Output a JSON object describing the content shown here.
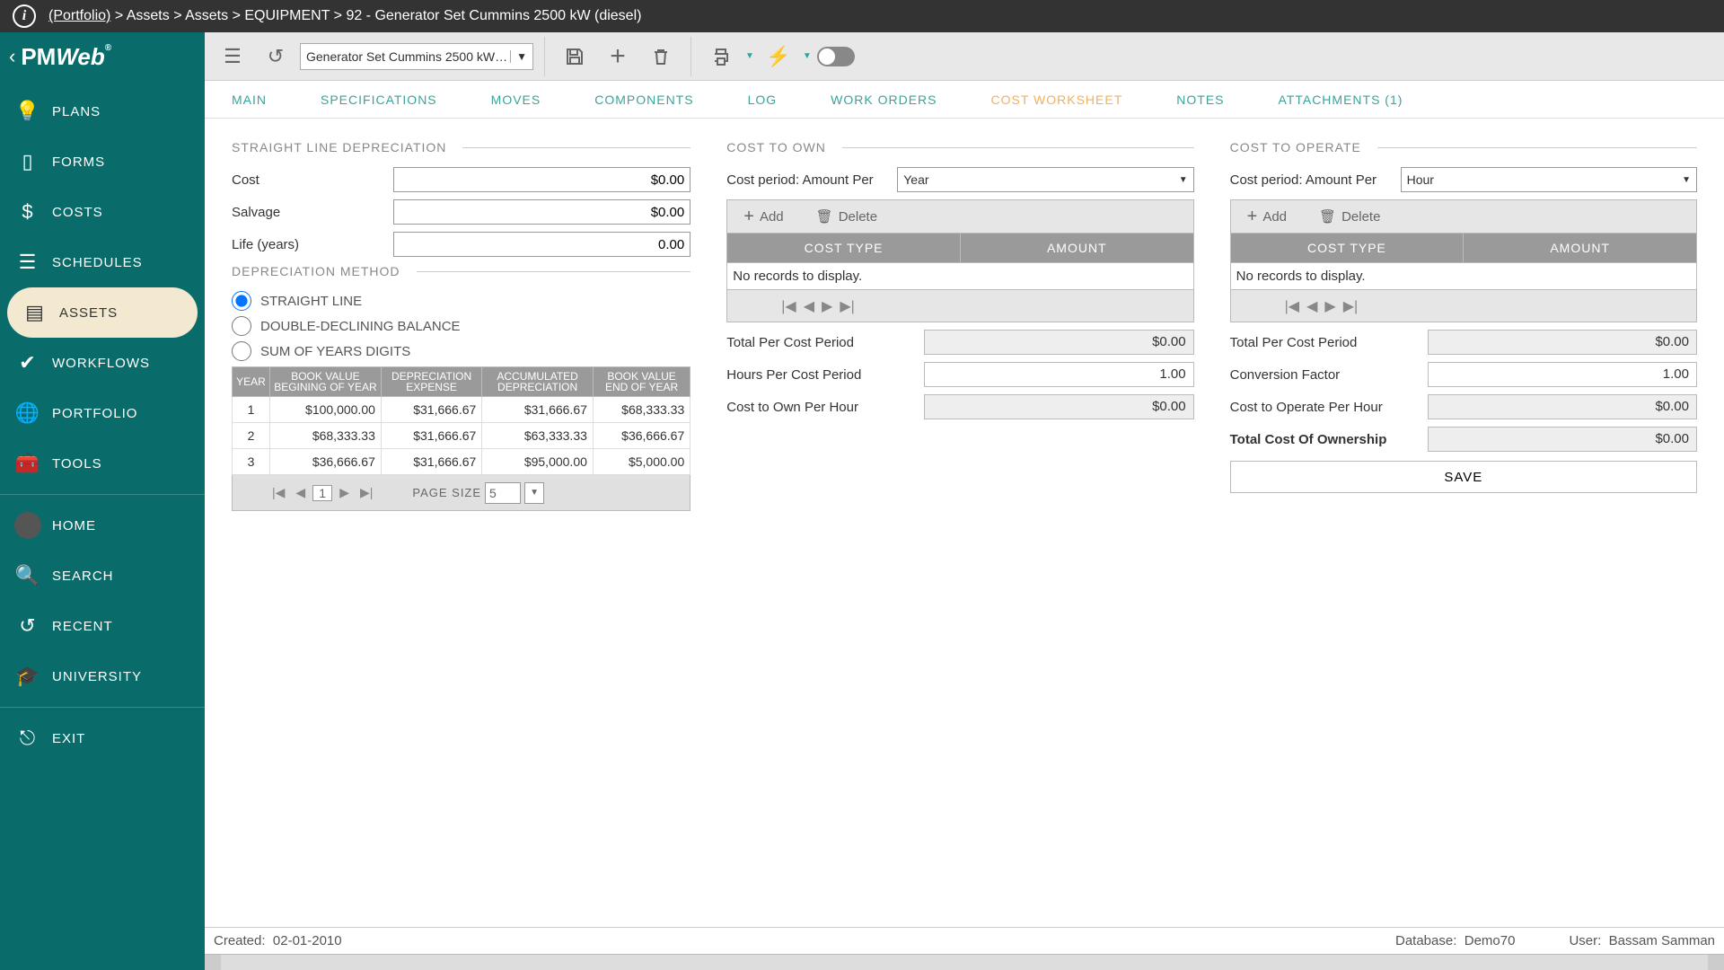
{
  "breadcrumb": {
    "portfolio": "(Portfolio)",
    "sep": " > ",
    "parts": [
      "Assets",
      "Assets",
      "EQUIPMENT",
      "92 - Generator Set Cummins 2500 kW (diesel)"
    ]
  },
  "logo": {
    "text": "PMWeb",
    "reg": "®"
  },
  "sidebar": {
    "items": [
      {
        "label": "PLANS"
      },
      {
        "label": "FORMS"
      },
      {
        "label": "COSTS"
      },
      {
        "label": "SCHEDULES"
      },
      {
        "label": "ASSETS"
      },
      {
        "label": "WORKFLOWS"
      },
      {
        "label": "PORTFOLIO"
      },
      {
        "label": "TOOLS"
      }
    ],
    "lower": [
      {
        "label": "HOME"
      },
      {
        "label": "SEARCH"
      },
      {
        "label": "RECENT"
      },
      {
        "label": "UNIVERSITY"
      }
    ],
    "exit": {
      "label": "EXIT"
    }
  },
  "toolbar": {
    "asset_selected": "Generator Set Cummins 2500 kW (diesel)"
  },
  "tabs": [
    "MAIN",
    "SPECIFICATIONS",
    "MOVES",
    "COMPONENTS",
    "LOG",
    "WORK ORDERS",
    "COST WORKSHEET",
    "NOTES",
    "ATTACHMENTS (1)"
  ],
  "active_tab": 6,
  "sld": {
    "title": "STRAIGHT LINE DEPRECIATION",
    "cost_label": "Cost",
    "cost_value": "$0.00",
    "salvage_label": "Salvage",
    "salvage_value": "$0.00",
    "life_label": "Life (years)",
    "life_value": "0.00",
    "method_title": "DEPRECIATION METHOD",
    "opt1": "STRAIGHT LINE",
    "opt2": "DOUBLE-DECLINING BALANCE",
    "opt3": "SUM OF YEARS DIGITS",
    "table_headers": [
      "YEAR",
      "BOOK VALUE BEGINING OF YEAR",
      "DEPRECIATION EXPENSE",
      "ACCUMULATED DEPRECIATION",
      "BOOK VALUE END OF YEAR"
    ],
    "rows": [
      {
        "y": "1",
        "b": "$100,000.00",
        "d": "$31,666.67",
        "a": "$31,666.67",
        "e": "$68,333.33"
      },
      {
        "y": "2",
        "b": "$68,333.33",
        "d": "$31,666.67",
        "a": "$63,333.33",
        "e": "$36,666.67"
      },
      {
        "y": "3",
        "b": "$36,666.67",
        "d": "$31,666.67",
        "a": "$95,000.00",
        "e": "$5,000.00"
      }
    ],
    "page_current": "1",
    "page_size_label": "PAGE SIZE",
    "page_size": "5"
  },
  "cto": {
    "title": "COST TO OWN",
    "period_label": "Cost period: Amount Per",
    "period_value": "Year",
    "add": "Add",
    "delete": "Delete",
    "col1": "COST TYPE",
    "col2": "AMOUNT",
    "empty": "No records to display.",
    "total_label": "Total Per Cost Period",
    "total": "$0.00",
    "hours_label": "Hours Per Cost Period",
    "hours": "1.00",
    "perhour_label": "Cost to Own Per Hour",
    "perhour": "$0.00"
  },
  "cop": {
    "title": "COST TO OPERATE",
    "period_label": "Cost period: Amount Per",
    "period_value": "Hour",
    "add": "Add",
    "delete": "Delete",
    "col1": "COST TYPE",
    "col2": "AMOUNT",
    "empty": "No records to display.",
    "total_label": "Total Per Cost Period",
    "total": "$0.00",
    "conv_label": "Conversion Factor",
    "conv": "1.00",
    "perhour_label": "Cost to Operate Per Hour",
    "perhour": "$0.00",
    "tco_label": "Total Cost Of Ownership",
    "tco": "$0.00",
    "save": "SAVE"
  },
  "status": {
    "created_label": "Created:",
    "created": "02-01-2010",
    "db_label": "Database:",
    "db": "Demo70",
    "user_label": "User:",
    "user": "Bassam Samman"
  }
}
